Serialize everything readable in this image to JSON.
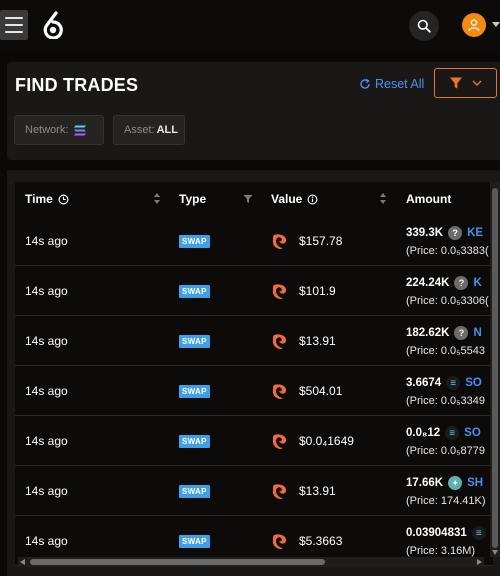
{
  "header": {
    "menu_icon": "hamburger-icon",
    "logo_icon": "brand-logo",
    "search_icon": "search-icon",
    "avatar_icon": "user-avatar-icon"
  },
  "filters": {
    "title": "FIND TRADES",
    "reset_label": "Reset All",
    "network_label": "Network:",
    "asset_label": "Asset:",
    "asset_value": "ALL"
  },
  "table": {
    "columns": [
      "Time",
      "Type",
      "Value",
      "Amount"
    ],
    "rows": [
      {
        "time": "14s ago",
        "type": "SWAP",
        "value": "$157.78",
        "amount": "339.3K",
        "token_icon": "question",
        "token": "KE",
        "price": "(Price: 0.0₅3383("
      },
      {
        "time": "14s ago",
        "type": "SWAP",
        "value": "$101.9",
        "amount": "224.24K",
        "token_icon": "question",
        "token": "K",
        "price": "(Price: 0.0₅3306("
      },
      {
        "time": "14s ago",
        "type": "SWAP",
        "value": "$13.91",
        "amount": "182.62K",
        "token_icon": "question",
        "token": "N",
        "price": "(Price: 0.0₅5543"
      },
      {
        "time": "14s ago",
        "type": "SWAP",
        "value": "$504.01",
        "amount": "3.6674",
        "token_icon": "sol",
        "token": "SO",
        "price": "(Price: 0.0₅3349"
      },
      {
        "time": "14s ago",
        "type": "SWAP",
        "value": "$0.0₄1649",
        "amount": "0.0₈12",
        "token_icon": "sol",
        "token": "SO",
        "price": "(Price: 0.0₅8779"
      },
      {
        "time": "14s ago",
        "type": "SWAP",
        "value": "$13.91",
        "amount": "17.66K",
        "token_icon": "sh",
        "token": "SH",
        "price": "(Price: 174.41K)"
      },
      {
        "time": "14s ago",
        "type": "SWAP",
        "value": "$5.3663",
        "amount": "0.03904831",
        "token_icon": "sol",
        "token": "",
        "price": "(Price: 3.16M)"
      }
    ]
  },
  "colors": {
    "accent_orange": "#e9742a",
    "link_blue": "#4a90f0",
    "swap_badge": "#3fa0e8",
    "avatar": "#f28a13"
  }
}
